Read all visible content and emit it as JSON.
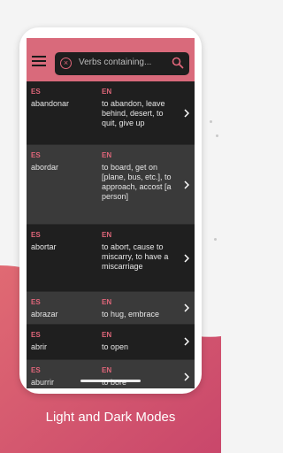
{
  "search": {
    "placeholder": "Verbs containing..."
  },
  "list": {
    "rows": [
      {
        "es_label": "ES",
        "en_label": "EN",
        "es": "abandonar",
        "en": "to abandon, leave behind, desert, to quit, give up"
      },
      {
        "es_label": "ES",
        "en_label": "EN",
        "es": "abordar",
        "en": "to board, get on [plane, bus, etc.], to approach, accost [a person]"
      },
      {
        "es_label": "ES",
        "en_label": "EN",
        "es": "abortar",
        "en": "to abort, cause to miscarry, to have a miscarriage"
      },
      {
        "es_label": "ES",
        "en_label": "EN",
        "es": "abrazar",
        "en": "to hug, embrace"
      },
      {
        "es_label": "ES",
        "en_label": "EN",
        "es": "abrir",
        "en": "to open"
      },
      {
        "es_label": "ES",
        "en_label": "EN",
        "es": "aburrir",
        "en": "to bore"
      }
    ]
  },
  "caption": "Light and Dark Modes",
  "colors": {
    "accent": "#e0667a",
    "appbar": "#d96a7b",
    "background_wave": "#d45a70"
  }
}
